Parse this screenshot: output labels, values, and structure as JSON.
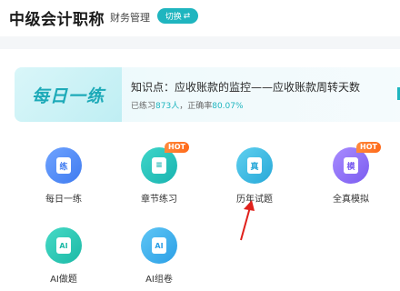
{
  "header": {
    "title": "中级会计职称",
    "subject": "财务管理",
    "switch_label": "切换",
    "switch_icon": "⇄"
  },
  "daily": {
    "badge": "每日一练",
    "knowledge_point": "知识点：应收账款的监控——应收账款周转天数",
    "stats_prefix": "已练习",
    "practiced_count": "873人",
    "stats_mid": "，正确率",
    "accuracy": "80.07%"
  },
  "tiles": [
    {
      "label": "每日一练",
      "glyph": "练",
      "hot": ""
    },
    {
      "label": "章节练习",
      "glyph": "≡",
      "hot": "HOT"
    },
    {
      "label": "历年试题",
      "glyph": "真",
      "hot": ""
    },
    {
      "label": "全真模拟",
      "glyph": "模",
      "hot": "HOT"
    },
    {
      "label": "AI做题",
      "glyph": "AI",
      "hot": ""
    },
    {
      "label": "AI组卷",
      "glyph": "AI",
      "hot": ""
    }
  ],
  "colors": {
    "accent": "#1fb5bf",
    "hot": "#ff7a2a",
    "arrow": "#e0201b"
  }
}
